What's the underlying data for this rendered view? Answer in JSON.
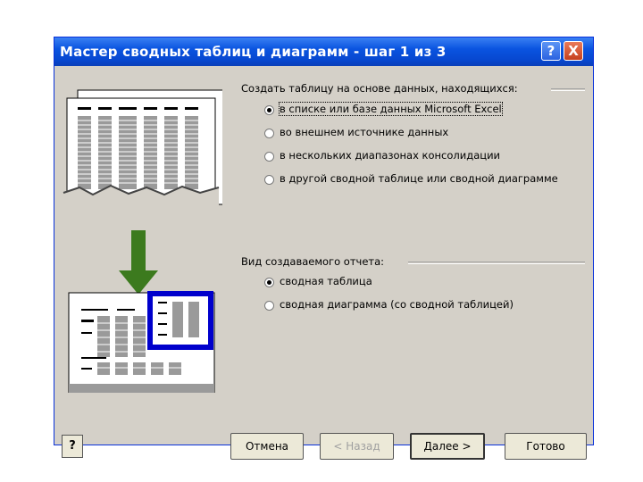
{
  "window": {
    "title": "Мастер сводных таблиц и диаграмм - шаг 1 из 3",
    "help_button": "?",
    "close_button": "X"
  },
  "source_group": {
    "label": "Создать таблицу на основе данных, находящихся:",
    "options": [
      {
        "label": "в списке или базе данных Microsoft Excel",
        "selected": true
      },
      {
        "label": "во внешнем источнике данных",
        "selected": false
      },
      {
        "label": "в нескольких диапазонах консолидации",
        "selected": false
      },
      {
        "label": "в другой сводной таблице или сводной диаграмме",
        "selected": false
      }
    ]
  },
  "report_group": {
    "label": "Вид создаваемого отчета:",
    "options": [
      {
        "label": "сводная таблица",
        "selected": true
      },
      {
        "label": "сводная диаграмма (со сводной таблицей)",
        "selected": false
      }
    ]
  },
  "buttons": {
    "help": "?",
    "cancel": "Отмена",
    "back": "< Назад",
    "next": "Далее >",
    "finish": "Готово"
  },
  "colors": {
    "titlebar": "#0a54e0",
    "dialog_bg": "#d4d0c8",
    "arrow": "#3c7a1e",
    "pivot_frame": "#0000cc"
  }
}
